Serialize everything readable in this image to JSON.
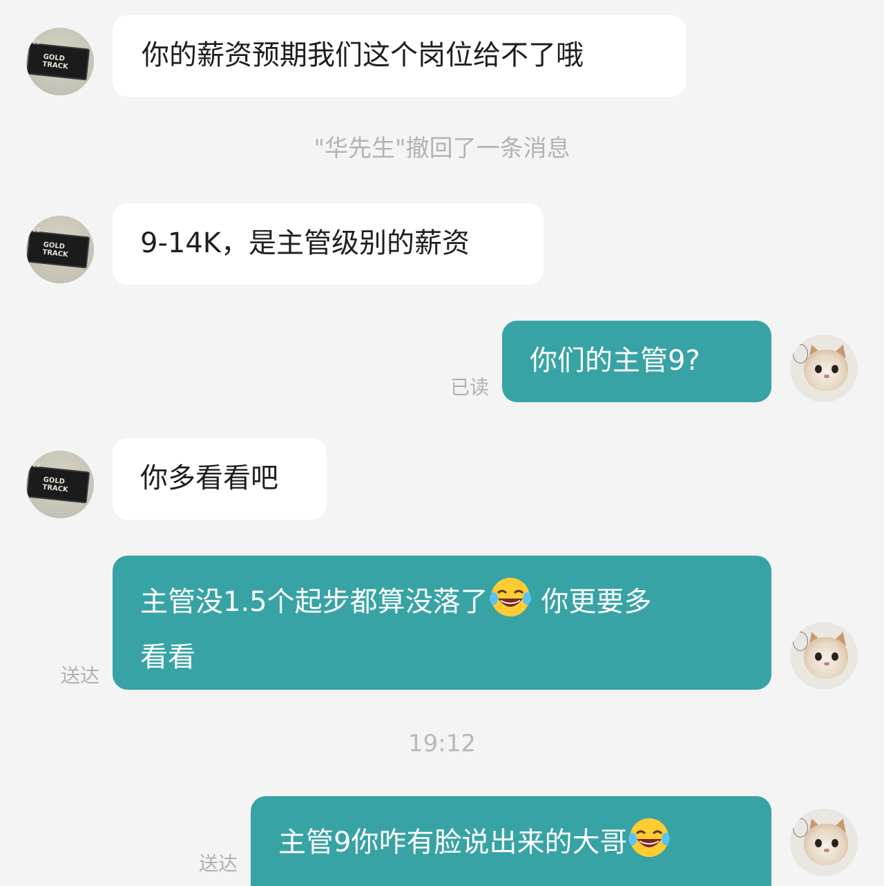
{
  "messages": [
    {
      "side": "in",
      "text": "你的薪资预期我们这个岗位给不了哦"
    },
    {
      "type": "system",
      "text": "\"华先生\"撤回了一条消息"
    },
    {
      "side": "in",
      "text": "9-14K，是主管级别的薪资"
    },
    {
      "side": "out",
      "text": "你们的主管9?",
      "status": "已读"
    },
    {
      "side": "in",
      "text": "你多看看吧"
    },
    {
      "side": "out",
      "line1": "主管没1.5个起步都算没落了",
      "line1b": "你更要多",
      "line2": "看看",
      "status": "送达",
      "emoji": "face-with-tears-of-joy"
    },
    {
      "type": "time",
      "text": "19:12"
    },
    {
      "side": "out",
      "text": "主管9你咋有脸说出来的大哥",
      "status": "送达",
      "emoji": "face-with-tears-of-joy"
    }
  ],
  "avatars": {
    "left": {
      "icon": "tv-sign-avatar",
      "num": "19",
      "label1": "GOLD",
      "label2": "TRACK"
    },
    "right": {
      "icon": "cat-avatar"
    }
  },
  "colors": {
    "outgoing": "#38a3a5",
    "incoming": "#ffffff",
    "background": "#f4f4f4"
  }
}
